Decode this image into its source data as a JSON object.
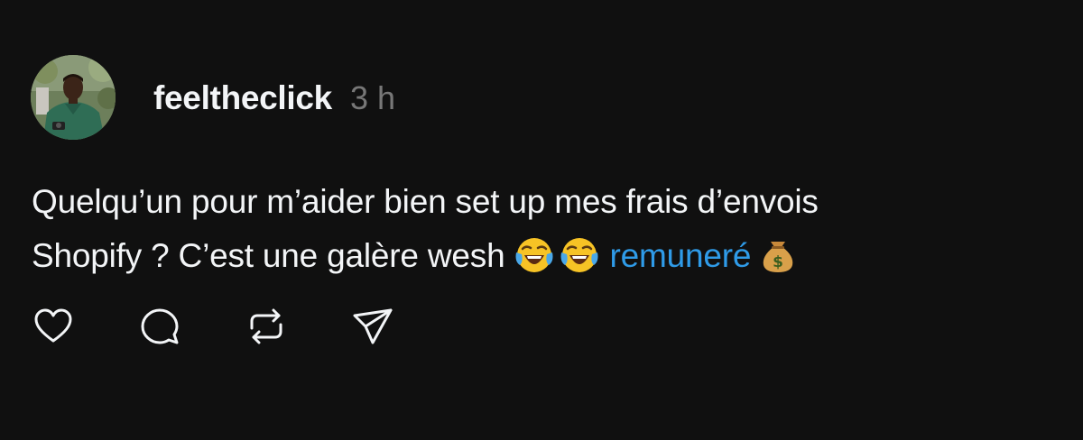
{
  "post": {
    "author": {
      "username": "feeltheclick",
      "avatar_icon": "profile-photo-avatar"
    },
    "timestamp": "3 h",
    "text": {
      "line1": "Quelqu’un pour m’aider bien set up mes frais d’envois",
      "line2_prefix": "Shopify ? C’est une galère wesh",
      "emojis": [
        "face-with-tears-of-joy",
        "face-with-tears-of-joy",
        "money-bag"
      ],
      "link": "remuneré"
    },
    "actions": [
      "heart-icon",
      "comment-icon",
      "repost-icon",
      "share-icon"
    ]
  },
  "colors": {
    "background": "#101010",
    "text": "#f3f5f7",
    "muted": "#777777",
    "link": "#2f9be8",
    "icon": "#f3f5f7"
  }
}
